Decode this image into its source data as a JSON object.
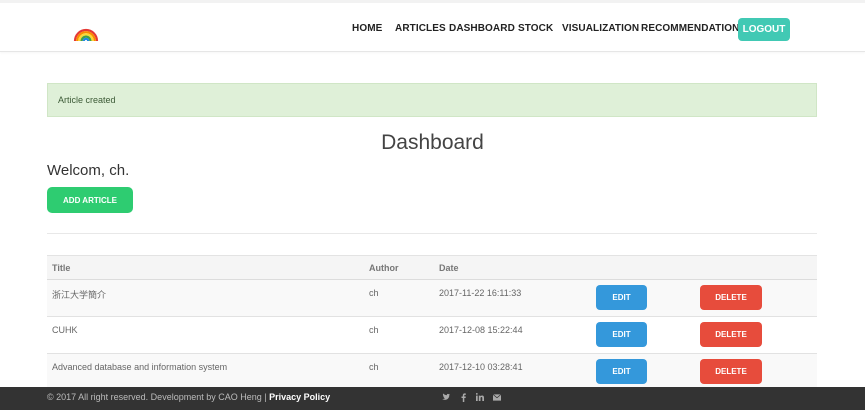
{
  "nav": {
    "items": [
      "HOME",
      "ARTICLES",
      "DASHBOARD",
      "STOCK",
      "VISUALIZATION",
      "RECOMMENDATION"
    ],
    "logout": "LOGOUT",
    "logo_icon": "rainbow-icon"
  },
  "alert": {
    "message": "Article created"
  },
  "page": {
    "title": "Dashboard",
    "welcome": "Welcom, ch.",
    "add_button": "ADD ARTICLE"
  },
  "table": {
    "headers": {
      "title": "Title",
      "author": "Author",
      "date": "Date"
    },
    "rows": [
      {
        "title": "浙江大学簡介",
        "author": "ch",
        "date": "2017-11-22 16:11:33",
        "edit": "EDIT",
        "delete": "DELETE"
      },
      {
        "title": "CUHK",
        "author": "ch",
        "date": "2017-12-08 15:22:44",
        "edit": "EDIT",
        "delete": "DELETE"
      },
      {
        "title": "Advanced database and information system",
        "author": "ch",
        "date": "2017-12-10 03:28:41",
        "edit": "EDIT",
        "delete": "DELETE"
      }
    ]
  },
  "footer": {
    "copyright": "© 2017 All right reserved. Development by CAO Heng",
    "separator": "|",
    "privacy": "Privacy Policy",
    "social_icons": [
      "twitter-icon",
      "facebook-icon",
      "linkedin-icon",
      "envelope-icon"
    ]
  },
  "colors": {
    "logout": "#41c9b4",
    "add": "#2ecc71",
    "edit": "#3498db",
    "delete": "#e74c3c",
    "alert_bg": "#dff0d8",
    "footer_bg": "#333333"
  }
}
